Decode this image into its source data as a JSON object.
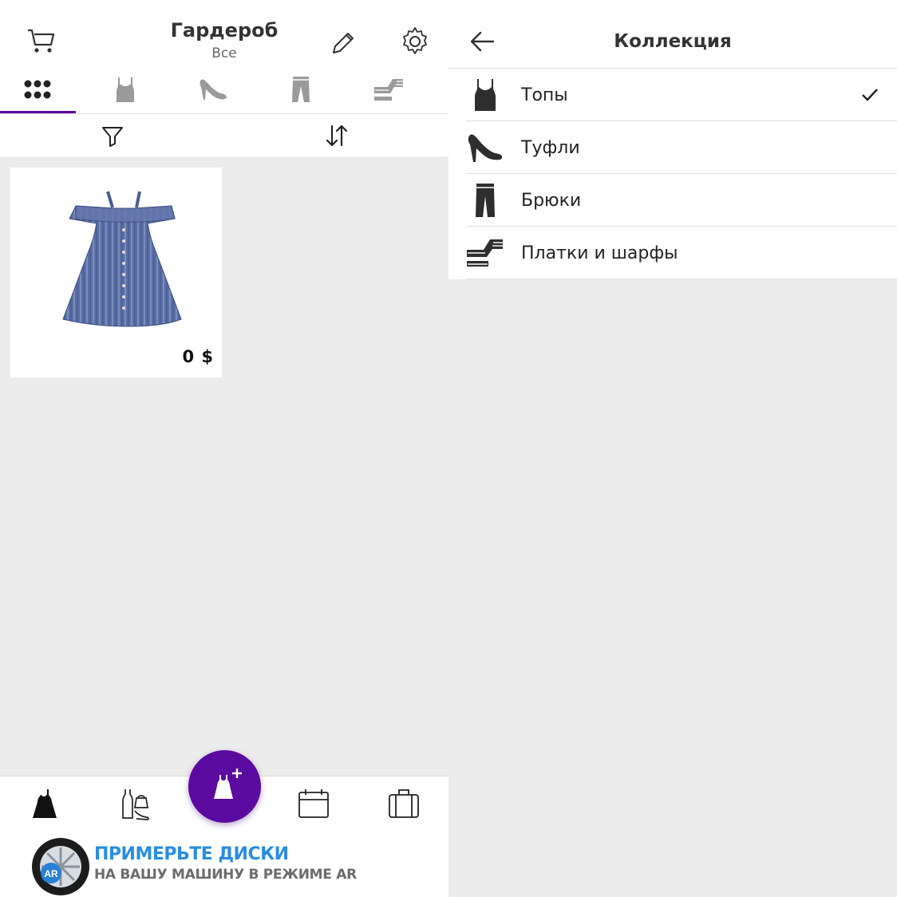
{
  "wardrobe": {
    "title": "Гардероб",
    "subtitle": "Все",
    "header_icons": [
      "cart-icon",
      "pencil-icon",
      "gear-icon"
    ],
    "category_tabs": [
      {
        "name": "all",
        "icon": "grid-icon",
        "active": true
      },
      {
        "name": "tops",
        "icon": "top-icon",
        "active": false
      },
      {
        "name": "shoes",
        "icon": "heel-icon",
        "active": false
      },
      {
        "name": "pants",
        "icon": "pants-icon",
        "active": false
      },
      {
        "name": "scarves",
        "icon": "scarf-icon",
        "active": false
      }
    ],
    "toolbar_icons": [
      "filter-icon",
      "sort-icon"
    ],
    "items": [
      {
        "price": "0 $",
        "image": "blue-striped-dress"
      }
    ],
    "bottom_nav": [
      "dress-icon",
      "outfit-icon",
      "add-item-icon",
      "calendar-icon",
      "suitcase-icon"
    ],
    "ad": {
      "line1": "ПРИМЕРЬТЕ ДИСКИ",
      "line2": "НА ВАШУ МАШИНУ В РЕЖИМЕ AR",
      "badge": "AR"
    }
  },
  "collection": {
    "title": "Коллекция",
    "items": [
      {
        "label": "Топы",
        "icon": "top-icon",
        "checked": true
      },
      {
        "label": "Туфли",
        "icon": "heel-icon",
        "checked": false
      },
      {
        "label": "Брюки",
        "icon": "pants-icon",
        "checked": false
      },
      {
        "label": "Платки и шарфы",
        "icon": "scarf-icon",
        "checked": false
      }
    ]
  },
  "colors": {
    "accent": "#5b0aa0",
    "background": "#ececec",
    "ad_blue": "#2a8de0",
    "inactive_icon": "#9a9a9a"
  }
}
